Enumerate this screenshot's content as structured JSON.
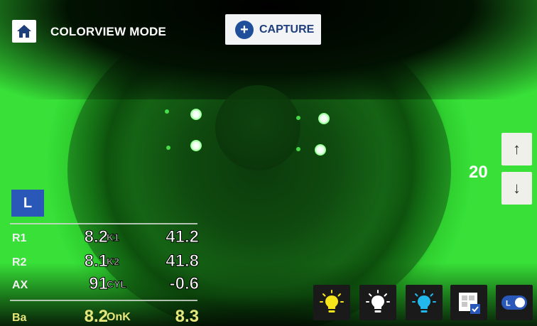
{
  "header": {
    "home_icon": "home-icon",
    "mode_title": "COLORVIEW MODE",
    "capture": {
      "label": "CAPTURE",
      "icon": "plus-circle-icon"
    }
  },
  "step": {
    "value": "20",
    "up_icon": "arrow-up-icon",
    "down_icon": "arrow-down-icon"
  },
  "side": {
    "label": "L"
  },
  "measurements": [
    {
      "label": "R1",
      "value": "8.2",
      "k_label": "K1",
      "k_value": "41.2"
    },
    {
      "label": "R2",
      "value": "8.1",
      "k_label": "K2",
      "k_value": "41.8"
    },
    {
      "label": "AX",
      "value": "91",
      "k_label": "CYL",
      "k_value": "-0.6"
    }
  ],
  "bottom_row": {
    "label": "Ba",
    "value": "8.2",
    "k_label": "OnK",
    "k_value": "8.3"
  },
  "toolbar": [
    {
      "icon": "yellow-bulb-icon",
      "color": "#f5e51a"
    },
    {
      "icon": "white-bulb-icon",
      "color": "#ffffff"
    },
    {
      "icon": "blue-bulb-icon",
      "color": "#22b8ee"
    },
    {
      "icon": "grid-check-icon"
    },
    {
      "icon": "toggle-icon",
      "toggle_label": "L"
    }
  ],
  "colors": {
    "accent_blue": "#2a58b8",
    "capture_blue": "#1f4f9a",
    "fluorescein_green": "#2fcf2f"
  }
}
